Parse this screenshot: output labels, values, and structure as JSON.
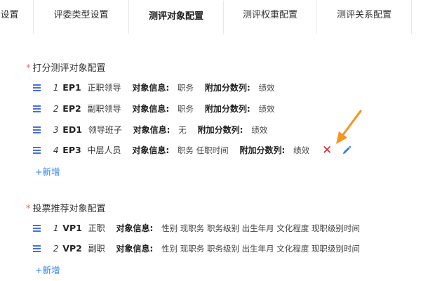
{
  "tabs": [
    {
      "label": "设置"
    },
    {
      "label": "评委类型设置"
    },
    {
      "label": "测评对象配置"
    },
    {
      "label": "测评权重配置"
    },
    {
      "label": "测评关系配置"
    }
  ],
  "scoring": {
    "required_mark": "*",
    "title": "打分测评对象配置",
    "items": [
      {
        "idx": "1",
        "code": "EP1",
        "name": "正职领导",
        "info_label": "对象信息:",
        "info": "职务",
        "extra_label": "附加分数列:",
        "extra": "绩效"
      },
      {
        "idx": "2",
        "code": "EP2",
        "name": "副职领导",
        "info_label": "对象信息:",
        "info": "职务",
        "extra_label": "附加分数列:",
        "extra": "绩效"
      },
      {
        "idx": "3",
        "code": "ED1",
        "name": "领导班子",
        "info_label": "对象信息:",
        "info": "无",
        "extra_label": "附加分数列:",
        "extra": "绩效"
      },
      {
        "idx": "4",
        "code": "EP3",
        "name": "中层人员",
        "info_label": "对象信息:",
        "info": "职务 任职时间",
        "extra_label": "附加分数列:",
        "extra": "绩效",
        "delete_icon": "✕"
      }
    ],
    "add_label": "+新增"
  },
  "voting": {
    "required_mark": "*",
    "title": "投票推荐对象配置",
    "items": [
      {
        "idx": "1",
        "code": "VP1",
        "name": "正职",
        "info_label": "对象信息:",
        "info": "性别 现职务 职务级别 出生年月 文化程度 现职级别时间"
      },
      {
        "idx": "2",
        "code": "VP2",
        "name": "副职",
        "info_label": "对象信息:",
        "info": "性别 现职务 职务级别 出生年月 文化程度 现职级别时间"
      }
    ],
    "add_label": "+新增"
  },
  "icons": {
    "drag": "drag-handle-icon",
    "delete": "delete-icon",
    "edit": "edit-pencil-icon"
  },
  "colors": {
    "accent": "#2f80ed",
    "required": "#f56c6c",
    "delete": "#e02424",
    "annotation_arrow": "#f7941d"
  }
}
